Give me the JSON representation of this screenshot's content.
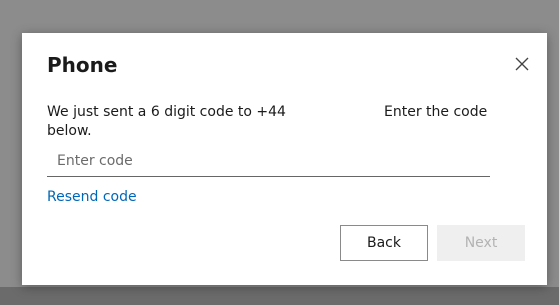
{
  "dialog": {
    "title": "Phone",
    "close_icon": "close-icon",
    "message": "We just sent a 6 digit code to +44",
    "message_line2": "below.",
    "message_hint": "Enter the code",
    "input_placeholder": "Enter code",
    "input_value": "",
    "resend_label": "Resend code",
    "back_label": "Back",
    "next_label": "Next"
  },
  "colors": {
    "link": "#0067b8",
    "overlay": "#8c8c8c",
    "disabled_button": "#efefef"
  }
}
